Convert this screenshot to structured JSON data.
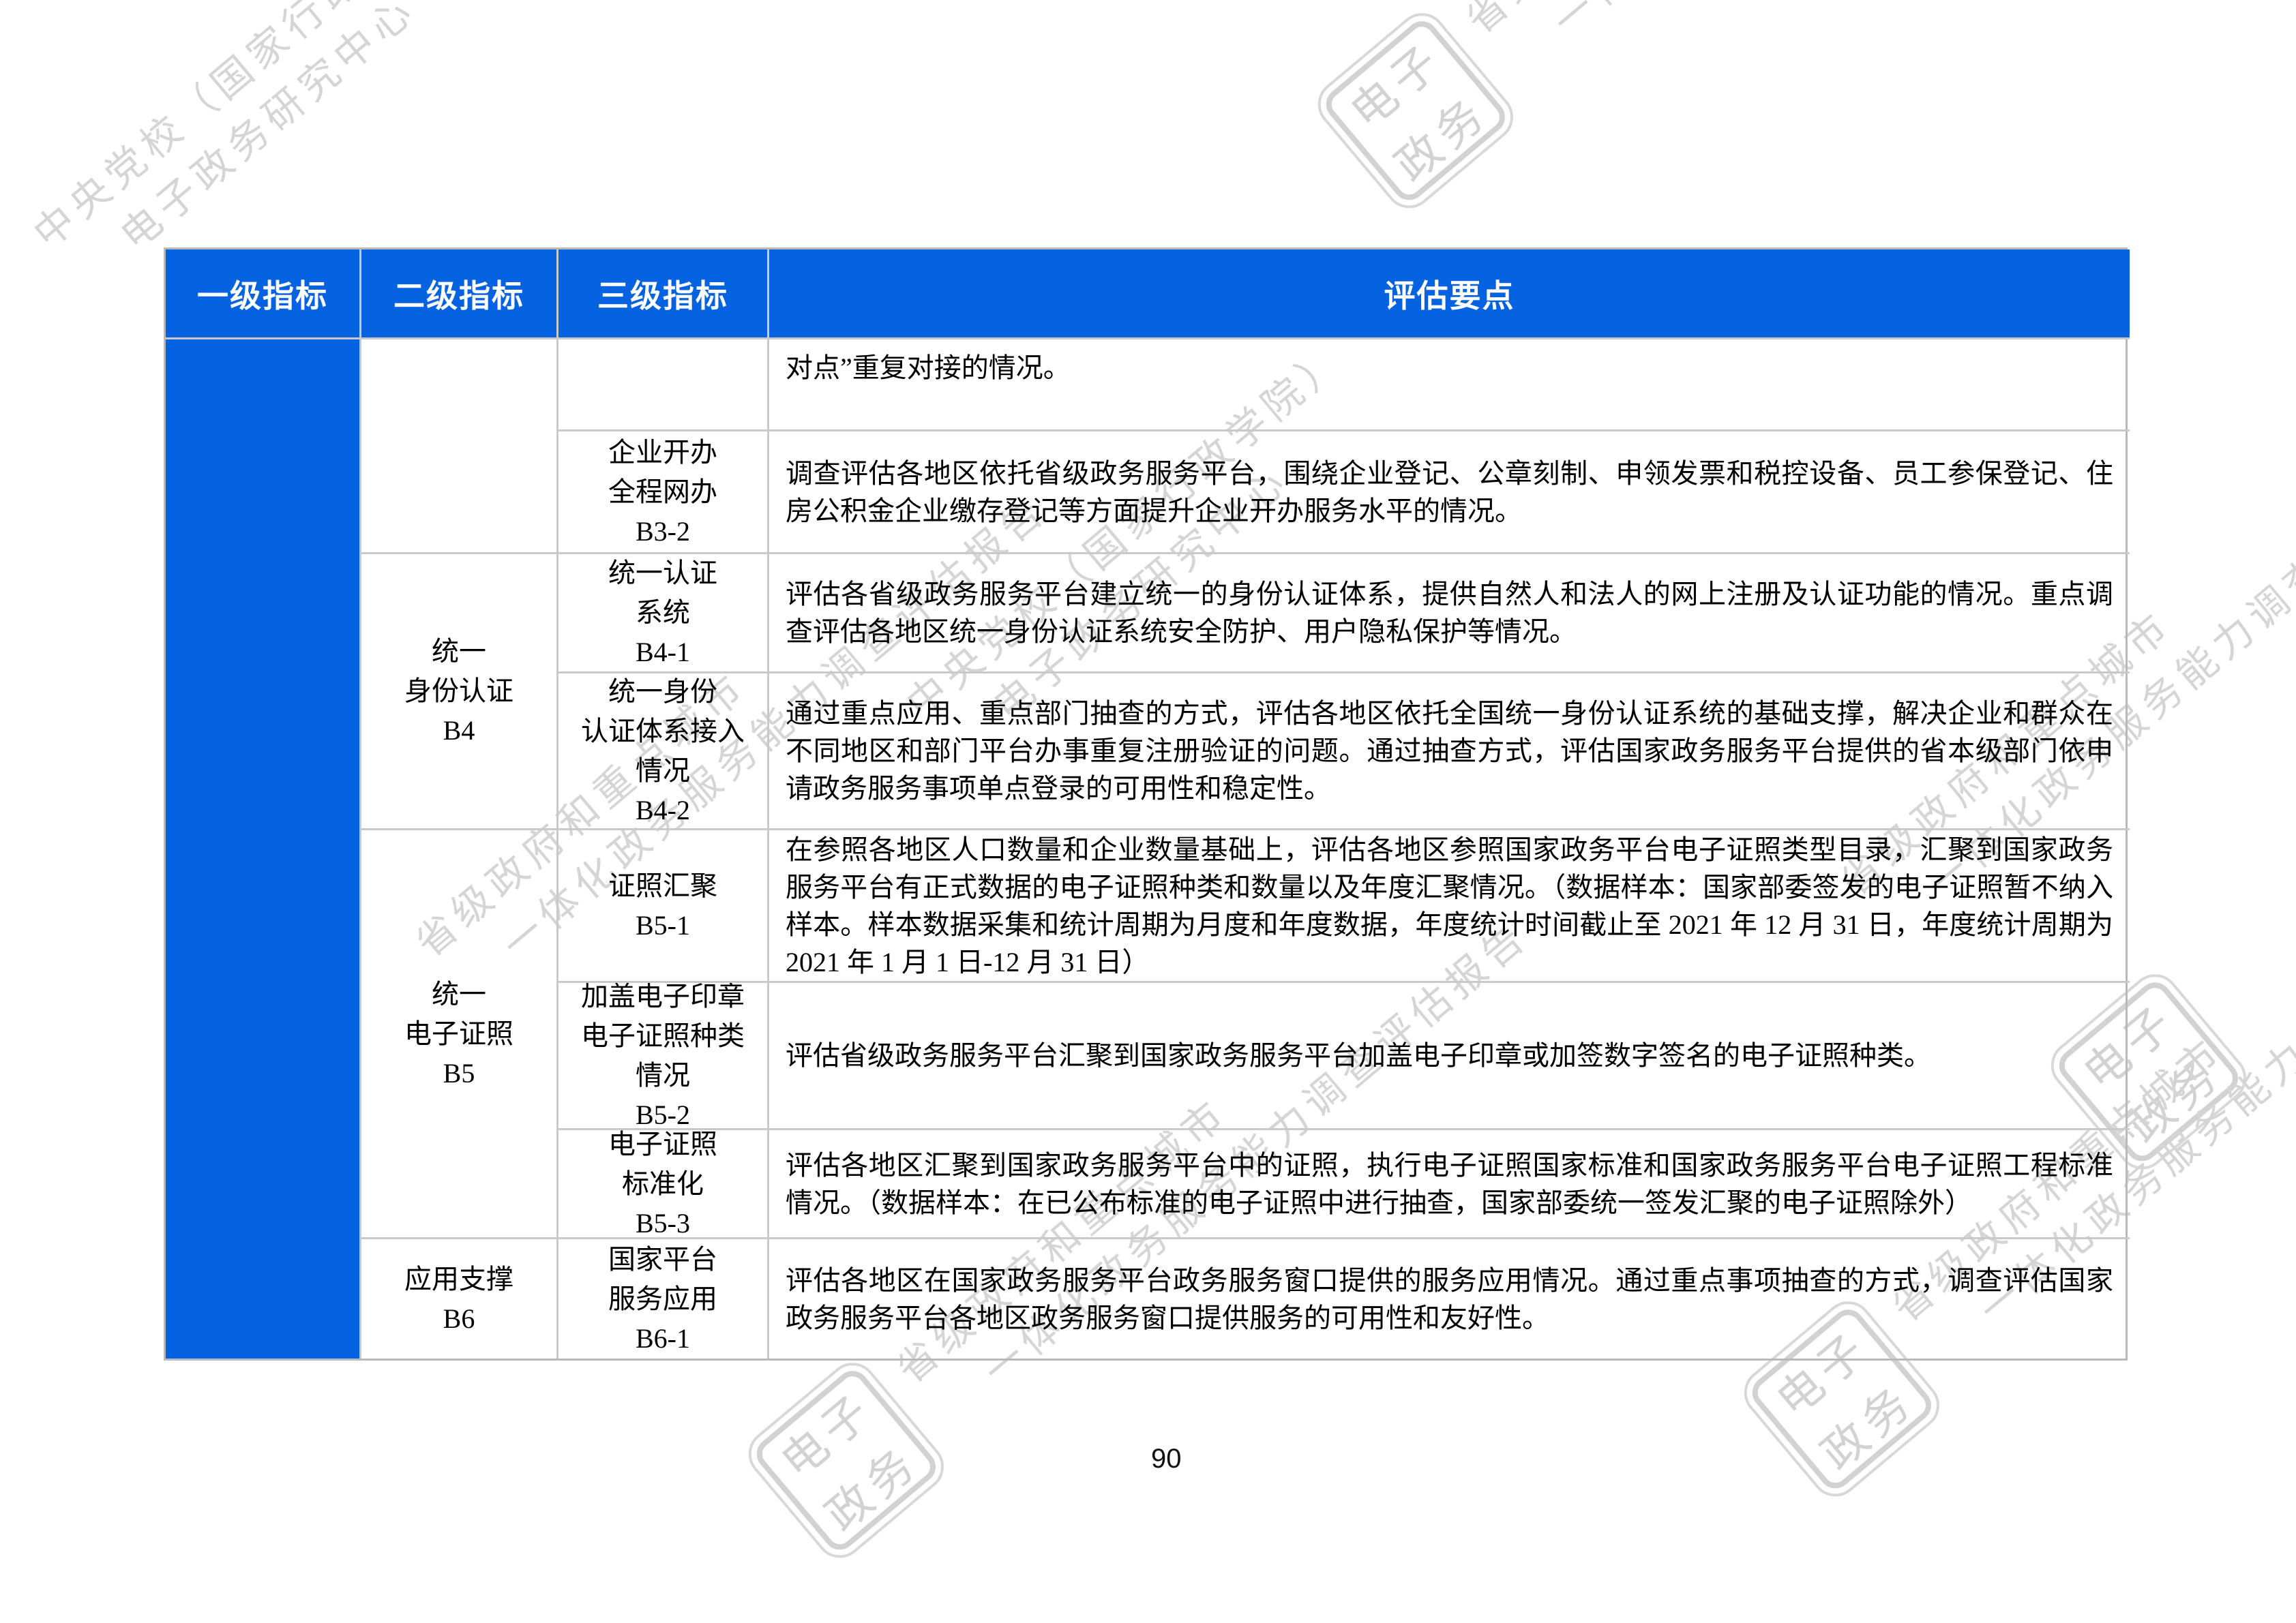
{
  "page": {
    "number": "90"
  },
  "table": {
    "headers": [
      "一级指标",
      "二级指标",
      "三级指标",
      "评估要点"
    ],
    "level2": {
      "b4": "统一\n身份认证\nB4",
      "b5": "统一\n电子证照\nB5",
      "b6": "应用支撑\nB6"
    },
    "rows": [
      {
        "level3": "",
        "point": "对点”重复对接的情况。"
      },
      {
        "level3": "企业开办\n全程网办\nB3-2",
        "point": "调查评估各地区依托省级政务服务平台，围绕企业登记、公章刻制、申领发票和税控设备、员工参保登记、住房公积金企业缴存登记等方面提升企业开办服务水平的情况。"
      },
      {
        "level3": "统一认证\n系统\nB4-1",
        "point": "评估各省级政务服务平台建立统一的身份认证体系，提供自然人和法人的网上注册及认证功能的情况。重点调查评估各地区统一身份认证系统安全防护、用户隐私保护等情况。"
      },
      {
        "level3": "统一身份\n认证体系接入\n情况\nB4-2",
        "point": "通过重点应用、重点部门抽查的方式，评估各地区依托全国统一身份认证系统的基础支撑，解决企业和群众在不同地区和部门平台办事重复注册验证的问题。通过抽查方式，评估国家政务服务平台提供的省本级部门依申请政务服务事项单点登录的可用性和稳定性。"
      },
      {
        "level3": "证照汇聚\nB5-1",
        "point": "在参照各地区人口数量和企业数量基础上，评估各地区参照国家政务平台电子证照类型目录，汇聚到国家政务服务平台有正式数据的电子证照种类和数量以及年度汇聚情况。（数据样本：国家部委签发的电子证照暂不纳入样本。样本数据采集和统计周期为月度和年度数据，年度统计时间截止至 2021 年 12 月 31 日，年度统计周期为 2021 年 1 月 1 日-12 月 31 日）"
      },
      {
        "level3": "加盖电子印章\n电子证照种类\n情况\nB5-2",
        "point": "评估省级政务服务平台汇聚到国家政务服务平台加盖电子印章或加签数字签名的电子证照种类。"
      },
      {
        "level3": "电子证照\n标准化\nB5-3",
        "point": "评估各地区汇聚到国家政务服务平台中的证照，执行电子证照国家标准和国家政务服务平台电子证照工程标准情况。（数据样本：在已公布标准的电子证照中进行抽查，国家部委统一签发汇聚的电子证照除外）"
      },
      {
        "level3": "国家平台\n服务应用\nB6-1",
        "point": "评估各地区在国家政务服务平台政务服务窗口提供的服务应用情况。通过重点事项抽查的方式，调查评估国家政务服务平台各地区政务服务窗口提供服务的可用性和友好性。"
      }
    ]
  },
  "watermarks": {
    "stamp_line1": "电子",
    "stamp_line2": "政务",
    "org_line1": "中央党校（国家行政学院）",
    "org_line2": "电子政务研究中心",
    "report_line1": "省级政府和重点城市",
    "report_line2": "一体化政务服务能力调查评估报告"
  }
}
